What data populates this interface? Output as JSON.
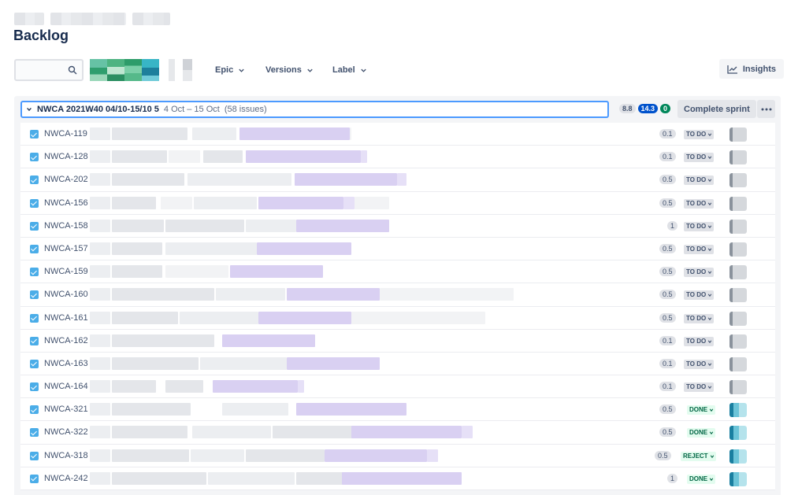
{
  "page": {
    "title": "Backlog"
  },
  "toolbar": {
    "search_placeholder": "",
    "filters": [
      "Epic",
      "Versions",
      "Label"
    ],
    "insights_label": "Insights"
  },
  "sprint": {
    "name": "NWCA 2021W40 04/10-15/10 5",
    "dates": "4 Oct – 15 Oct",
    "issue_count": "(58 issues)",
    "badges": {
      "not_started": "8.8",
      "in_progress": "14.3",
      "done": "0"
    },
    "complete_label": "Complete sprint"
  },
  "issues": [
    {
      "key": "NWCA-119",
      "estimate": "0.1",
      "status": "TO DO"
    },
    {
      "key": "NWCA-128",
      "estimate": "0.1",
      "status": "TO DO"
    },
    {
      "key": "NWCA-202",
      "estimate": "0.5",
      "status": "TO DO"
    },
    {
      "key": "NWCA-156",
      "estimate": "0.5",
      "status": "TO DO"
    },
    {
      "key": "NWCA-158",
      "estimate": "1",
      "status": "TO DO"
    },
    {
      "key": "NWCA-157",
      "estimate": "0.5",
      "status": "TO DO"
    },
    {
      "key": "NWCA-159",
      "estimate": "0.5",
      "status": "TO DO"
    },
    {
      "key": "NWCA-160",
      "estimate": "0.5",
      "status": "TO DO"
    },
    {
      "key": "NWCA-161",
      "estimate": "0.5",
      "status": "TO DO"
    },
    {
      "key": "NWCA-162",
      "estimate": "0.1",
      "status": "TO DO"
    },
    {
      "key": "NWCA-163",
      "estimate": "0.1",
      "status": "TO DO"
    },
    {
      "key": "NWCA-164",
      "estimate": "0.1",
      "status": "TO DO"
    },
    {
      "key": "NWCA-321",
      "estimate": "0.5",
      "status": "DONE"
    },
    {
      "key": "NWCA-322",
      "estimate": "0.5",
      "status": "DONE"
    },
    {
      "key": "NWCA-318",
      "estimate": "0.5",
      "status": "REJECT"
    },
    {
      "key": "NWCA-242",
      "estimate": "1",
      "status": "DONE"
    }
  ],
  "colors": {
    "todo_bg": "#dfe1e6",
    "done_bg": "#e3fcef",
    "done_text": "#006644",
    "accent_blue": "#0052cc",
    "accent_green": "#00875a",
    "story_icon": "#4bade8"
  },
  "icons": {
    "search": "search-icon",
    "chevron": "chevron-down-icon",
    "insights": "insights-chart-icon",
    "more": "more-dots-icon",
    "issue_type": "task-checkbox-icon"
  }
}
